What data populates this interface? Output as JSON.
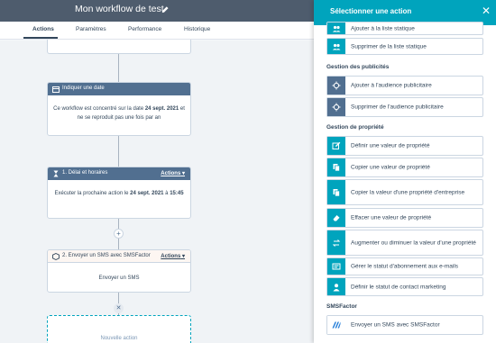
{
  "header": {
    "title": "Mon workflow de test"
  },
  "tabs": [
    {
      "label": "Actions",
      "active": true
    },
    {
      "label": "Paramètres"
    },
    {
      "label": "Performance"
    },
    {
      "label": "Historique"
    }
  ],
  "cards": {
    "date": {
      "title": "Indiquer une date",
      "body_prefix": "Ce workflow est concentré sur la date ",
      "body_date": "24 sept. 2021",
      "body_suffix": " et ne se reproduit pas une fois par an"
    },
    "delay": {
      "title": "1. Délai et horaires",
      "actions": "Actions",
      "body_prefix": "Exécuter la prochaine action le ",
      "body_date": "24 sept. 2021",
      "body_mid": " à ",
      "body_time": "15:45"
    },
    "sms": {
      "title": "2. Envoyer un SMS avec SMSFactor",
      "actions": "Actions",
      "body": "Envoyer un SMS"
    },
    "new_action": "Nouvelle action"
  },
  "panel": {
    "title": "Sélectionner une action",
    "top_items": [
      {
        "label": "Ajouter à la liste statique",
        "icon": "users-icon"
      },
      {
        "label": "Supprimer de la liste statique",
        "icon": "users-icon"
      }
    ],
    "ads": {
      "title": "Gestion des publicités",
      "items": [
        {
          "label": "Ajouter à l'audience publicitaire",
          "icon": "target-icon"
        },
        {
          "label": "Supprimer de l'audience publicitaire",
          "icon": "target-icon"
        }
      ]
    },
    "props": {
      "title": "Gestion de propriété",
      "items": [
        {
          "label": "Définir une valeur de propriété",
          "icon": "edit-icon"
        },
        {
          "label": "Copier une valeur de propriété",
          "icon": "copy-icon"
        },
        {
          "label": "Copier la valeur d'une propriété d'entreprise",
          "icon": "copy-icon"
        },
        {
          "label": "Effacer une valeur de propriété",
          "icon": "eraser-icon"
        },
        {
          "label": "Augmenter ou diminuer la valeur d'une propriété",
          "icon": "arrows-icon"
        },
        {
          "label": "Gérer le statut d'abonnement aux e-mails",
          "icon": "card-icon"
        },
        {
          "label": "Définir le statut de contact marketing",
          "icon": "user-icon"
        }
      ]
    },
    "sms": {
      "title": "SMSFactor",
      "items": [
        {
          "label": "Envoyer un SMS avec SMSFactor",
          "icon": "smsfactor-icon"
        }
      ]
    }
  },
  "colors": {
    "accent": "#00a4bd",
    "header": "#4e5c6d",
    "node": "#516f90"
  }
}
